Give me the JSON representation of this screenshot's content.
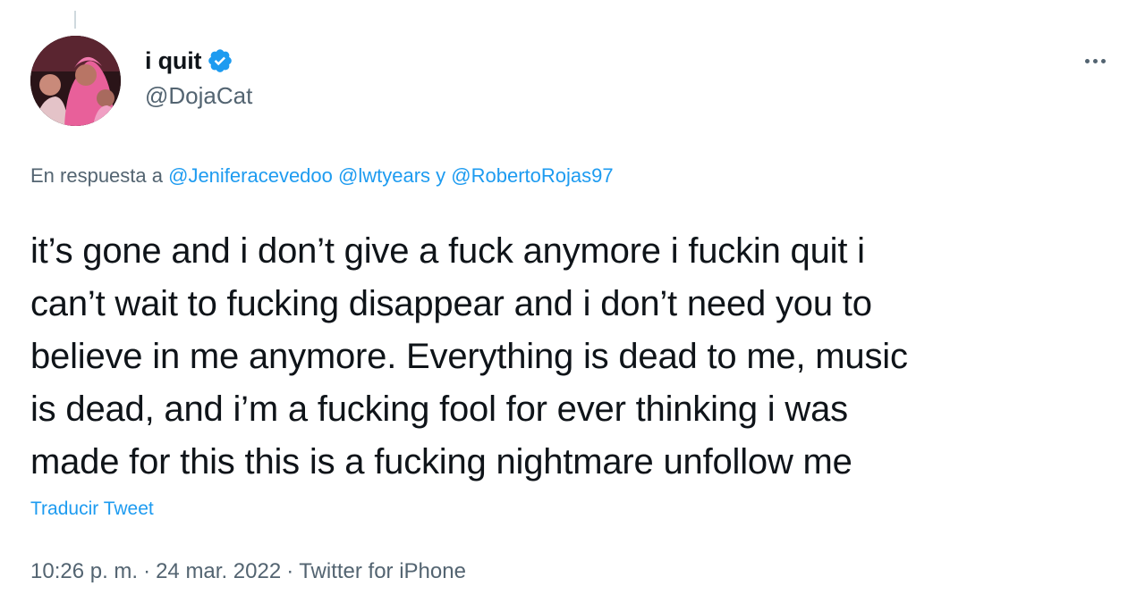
{
  "tweet": {
    "author": {
      "display_name": "i quit",
      "handle": "@DojaCat",
      "verified": true,
      "avatar_icon": "profile-photo"
    },
    "more_icon": "more-horizontal-icon",
    "reply_to": {
      "prefix": "En respuesta a",
      "mention1": "@Jeniferacevedoo",
      "mention2": "@lwtyears",
      "conjunction": "y",
      "mention3": "@RobertoRojas97"
    },
    "text": "it’s gone and i don’t give a fuck anymore i fuckin quit i\ncan’t wait to fucking disappear and i don’t need you to\nbelieve in me anymore. Everything is dead to me, music\nis dead, and i’m a fucking fool for ever thinking i was\nmade for this this is a fucking nightmare unfollow me",
    "translate_label": "Traducir Tweet",
    "time": "10:26 p. m.",
    "date": "24 mar. 2022",
    "source": "Twitter for iPhone",
    "separator": "·"
  },
  "colors": {
    "primary_text": "#0f1419",
    "secondary_text": "#536471",
    "accent": "#1d9bf0",
    "avatar_pink": "#e8609a"
  }
}
